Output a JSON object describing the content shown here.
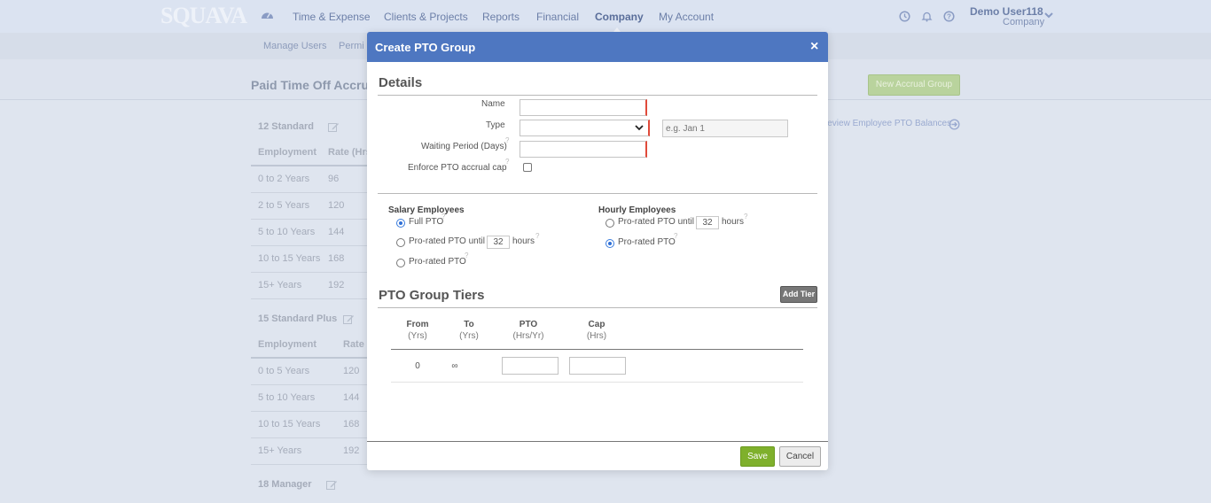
{
  "topnav": {
    "logo": "SQUAVA",
    "items": [
      "Time & Expense",
      "Clients & Projects",
      "Reports",
      "Financial",
      "Company",
      "My Account"
    ],
    "active": "Company",
    "user_name": "Demo User118",
    "user_company": "Company",
    "icons": [
      "dashboard-icon",
      "clock-icon",
      "bell-icon",
      "help-icon",
      "chevron-down-icon"
    ]
  },
  "subnav": {
    "items": [
      "Manage Users",
      "Permi"
    ]
  },
  "page": {
    "title": "Paid Time Off Accru",
    "new_accrual_label": "New Accrual Group",
    "review_link": "Review Employee PTO Balances"
  },
  "background_groups": [
    {
      "name": "12 Standard",
      "columns": [
        "Employment",
        "Rate (Hrs"
      ],
      "rows": [
        [
          "0 to 2 Years",
          "96"
        ],
        [
          "2 to 5 Years",
          "120"
        ],
        [
          "5 to 10 Years",
          "144"
        ],
        [
          "10 to 15 Years",
          "168"
        ],
        [
          "15+ Years",
          "192"
        ]
      ]
    },
    {
      "name": "15 Standard Plus",
      "columns": [
        "Employment",
        "Rate ("
      ],
      "rows": [
        [
          "0 to 5 Years",
          "120"
        ],
        [
          "5 to 10 Years",
          "144"
        ],
        [
          "10 to 15 Years",
          "168"
        ],
        [
          "15+ Years",
          "192"
        ]
      ]
    },
    {
      "name": "18 Manager",
      "columns": [],
      "rows": []
    }
  ],
  "modal": {
    "title": "Create PTO Group",
    "close": "×",
    "details_title": "Details",
    "fields": {
      "name_label": "Name",
      "type_label": "Type",
      "date_placeholder": "e.g. Jan 1",
      "waiting_label": "Waiting Period (Days)",
      "cap_label": "Enforce PTO accrual cap",
      "help_mark": "?"
    },
    "salary": {
      "title": "Salary Employees",
      "full": "Full PTO",
      "prorated_until": "Pro-rated PTO until",
      "until_value": "32",
      "hours": "hours",
      "prorated": "Pro-rated PTO",
      "selected": "Full PTO"
    },
    "hourly": {
      "title": "Hourly Employees",
      "prorated_until": "Pro-rated PTO until",
      "until_value": "32",
      "hours": "hours",
      "prorated": "Pro-rated PTO",
      "selected": "Pro-rated PTO"
    },
    "tiers": {
      "title": "PTO Group Tiers",
      "add_label": "Add Tier",
      "columns": [
        {
          "head": "From",
          "sub": "(Yrs)"
        },
        {
          "head": "To",
          "sub": "(Yrs)"
        },
        {
          "head": "PTO",
          "sub": "(Hrs/Yr)"
        },
        {
          "head": "Cap",
          "sub": "(Hrs)"
        }
      ],
      "rows": [
        {
          "from": "0",
          "to": "∞",
          "pto": "",
          "cap": ""
        }
      ]
    },
    "save_label": "Save",
    "cancel_label": "Cancel"
  },
  "colors": {
    "header": "#4e77c1",
    "save": "#7fb02c",
    "required": "#e04a3a",
    "radio_selected": "#2f6fd6"
  }
}
